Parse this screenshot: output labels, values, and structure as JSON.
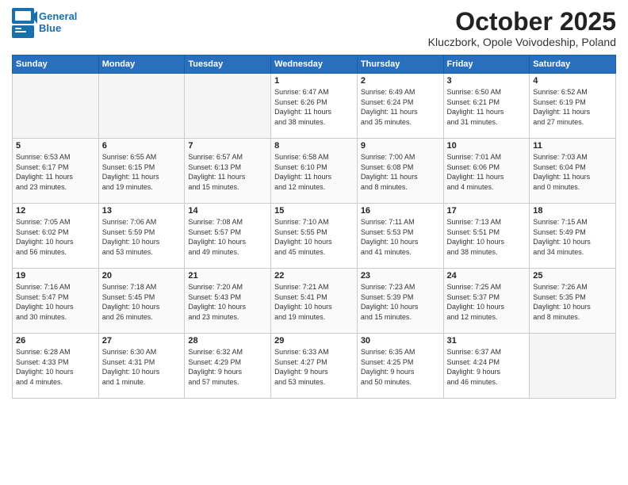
{
  "header": {
    "logo_line1": "General",
    "logo_line2": "Blue",
    "month_title": "October 2025",
    "location": "Kluczbork, Opole Voivodeship, Poland"
  },
  "days_of_week": [
    "Sunday",
    "Monday",
    "Tuesday",
    "Wednesday",
    "Thursday",
    "Friday",
    "Saturday"
  ],
  "weeks": [
    [
      {
        "day": "",
        "info": ""
      },
      {
        "day": "",
        "info": ""
      },
      {
        "day": "",
        "info": ""
      },
      {
        "day": "1",
        "info": "Sunrise: 6:47 AM\nSunset: 6:26 PM\nDaylight: 11 hours\nand 38 minutes."
      },
      {
        "day": "2",
        "info": "Sunrise: 6:49 AM\nSunset: 6:24 PM\nDaylight: 11 hours\nand 35 minutes."
      },
      {
        "day": "3",
        "info": "Sunrise: 6:50 AM\nSunset: 6:21 PM\nDaylight: 11 hours\nand 31 minutes."
      },
      {
        "day": "4",
        "info": "Sunrise: 6:52 AM\nSunset: 6:19 PM\nDaylight: 11 hours\nand 27 minutes."
      }
    ],
    [
      {
        "day": "5",
        "info": "Sunrise: 6:53 AM\nSunset: 6:17 PM\nDaylight: 11 hours\nand 23 minutes."
      },
      {
        "day": "6",
        "info": "Sunrise: 6:55 AM\nSunset: 6:15 PM\nDaylight: 11 hours\nand 19 minutes."
      },
      {
        "day": "7",
        "info": "Sunrise: 6:57 AM\nSunset: 6:13 PM\nDaylight: 11 hours\nand 15 minutes."
      },
      {
        "day": "8",
        "info": "Sunrise: 6:58 AM\nSunset: 6:10 PM\nDaylight: 11 hours\nand 12 minutes."
      },
      {
        "day": "9",
        "info": "Sunrise: 7:00 AM\nSunset: 6:08 PM\nDaylight: 11 hours\nand 8 minutes."
      },
      {
        "day": "10",
        "info": "Sunrise: 7:01 AM\nSunset: 6:06 PM\nDaylight: 11 hours\nand 4 minutes."
      },
      {
        "day": "11",
        "info": "Sunrise: 7:03 AM\nSunset: 6:04 PM\nDaylight: 11 hours\nand 0 minutes."
      }
    ],
    [
      {
        "day": "12",
        "info": "Sunrise: 7:05 AM\nSunset: 6:02 PM\nDaylight: 10 hours\nand 56 minutes."
      },
      {
        "day": "13",
        "info": "Sunrise: 7:06 AM\nSunset: 5:59 PM\nDaylight: 10 hours\nand 53 minutes."
      },
      {
        "day": "14",
        "info": "Sunrise: 7:08 AM\nSunset: 5:57 PM\nDaylight: 10 hours\nand 49 minutes."
      },
      {
        "day": "15",
        "info": "Sunrise: 7:10 AM\nSunset: 5:55 PM\nDaylight: 10 hours\nand 45 minutes."
      },
      {
        "day": "16",
        "info": "Sunrise: 7:11 AM\nSunset: 5:53 PM\nDaylight: 10 hours\nand 41 minutes."
      },
      {
        "day": "17",
        "info": "Sunrise: 7:13 AM\nSunset: 5:51 PM\nDaylight: 10 hours\nand 38 minutes."
      },
      {
        "day": "18",
        "info": "Sunrise: 7:15 AM\nSunset: 5:49 PM\nDaylight: 10 hours\nand 34 minutes."
      }
    ],
    [
      {
        "day": "19",
        "info": "Sunrise: 7:16 AM\nSunset: 5:47 PM\nDaylight: 10 hours\nand 30 minutes."
      },
      {
        "day": "20",
        "info": "Sunrise: 7:18 AM\nSunset: 5:45 PM\nDaylight: 10 hours\nand 26 minutes."
      },
      {
        "day": "21",
        "info": "Sunrise: 7:20 AM\nSunset: 5:43 PM\nDaylight: 10 hours\nand 23 minutes."
      },
      {
        "day": "22",
        "info": "Sunrise: 7:21 AM\nSunset: 5:41 PM\nDaylight: 10 hours\nand 19 minutes."
      },
      {
        "day": "23",
        "info": "Sunrise: 7:23 AM\nSunset: 5:39 PM\nDaylight: 10 hours\nand 15 minutes."
      },
      {
        "day": "24",
        "info": "Sunrise: 7:25 AM\nSunset: 5:37 PM\nDaylight: 10 hours\nand 12 minutes."
      },
      {
        "day": "25",
        "info": "Sunrise: 7:26 AM\nSunset: 5:35 PM\nDaylight: 10 hours\nand 8 minutes."
      }
    ],
    [
      {
        "day": "26",
        "info": "Sunrise: 6:28 AM\nSunset: 4:33 PM\nDaylight: 10 hours\nand 4 minutes."
      },
      {
        "day": "27",
        "info": "Sunrise: 6:30 AM\nSunset: 4:31 PM\nDaylight: 10 hours\nand 1 minute."
      },
      {
        "day": "28",
        "info": "Sunrise: 6:32 AM\nSunset: 4:29 PM\nDaylight: 9 hours\nand 57 minutes."
      },
      {
        "day": "29",
        "info": "Sunrise: 6:33 AM\nSunset: 4:27 PM\nDaylight: 9 hours\nand 53 minutes."
      },
      {
        "day": "30",
        "info": "Sunrise: 6:35 AM\nSunset: 4:25 PM\nDaylight: 9 hours\nand 50 minutes."
      },
      {
        "day": "31",
        "info": "Sunrise: 6:37 AM\nSunset: 4:24 PM\nDaylight: 9 hours\nand 46 minutes."
      },
      {
        "day": "",
        "info": ""
      }
    ]
  ]
}
